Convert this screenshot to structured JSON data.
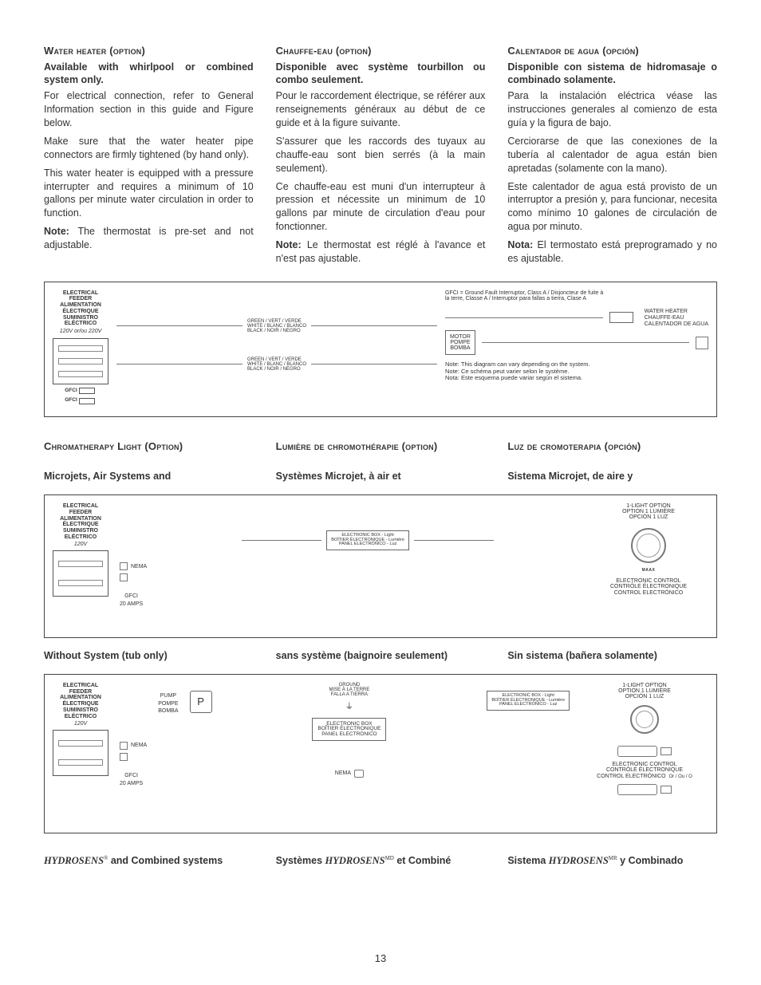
{
  "page_number": "13",
  "sections": {
    "water_heater": {
      "en": {
        "title": "Water heater (option)",
        "subtitle": "Available with whirlpool or combined system only.",
        "p1": "For electrical connection, refer to General Information section in this guide and Figure below.",
        "p2": "Make sure that the water heater pipe connectors are firmly tightened (by hand only).",
        "p3": "This water heater is equipped with a pressure interrupter and requires a minimum of 10 gallons per minute water circulation in order to function.",
        "note_label": "Note:",
        "note": "The thermostat is pre-set and not adjustable."
      },
      "fr": {
        "title": "Chauffe-eau (option)",
        "subtitle": "Disponible avec système tourbillon ou combo seulement.",
        "p1": "Pour le raccordement électrique, se référer aux renseignements généraux au début de ce guide et à la figure suivante.",
        "p2": "S'assurer que les raccords des tuyaux au chauffe-eau sont bien serrés (à la main seulement).",
        "p3": "Ce chauffe-eau est muni d'un interrupteur à pression et nécessite un minimum de 10 gallons par minute de circulation d'eau pour fonctionner.",
        "note_label": "Note:",
        "note": "Le thermostat est réglé à l'avance et n'est pas ajustable."
      },
      "es": {
        "title": "Calentador de agua (opción)",
        "subtitle": "Disponible con sistema de hidromasaje o combinado solamente.",
        "p1": "Para la instalación eléctrica véase las instrucciones generales al comienzo de esta guía y la figura de bajo.",
        "p2": "Cerciorarse de que las conexiones de la tubería al calentador de agua están bien apretadas (solamente con la mano).",
        "p3": "Este calentador de agua está provisto de un interruptor a presión y, para funcionar, necesita como mínimo 10 galones de circulación de agua por minuto.",
        "note_label": "Nota:",
        "note": "El termostato está preprogramado y no es ajustable."
      }
    },
    "chroma": {
      "en": "Chromatherapy Light (Option)",
      "fr": "Lumière de chromothérapie (option)",
      "es": "Luz de cromoterapia (opción)"
    },
    "subA": {
      "en": "Microjets, Air Systems and",
      "fr": "Systèmes Microjet, à air et",
      "es": "Sistema Microjet, de aire y"
    },
    "subB": {
      "en": "Without System (tub only)",
      "fr": "sans système (baignoire seulement)",
      "es": "Sin sistema (bañera solamente)"
    },
    "hydro": {
      "name": "HYDROSENS",
      "en_suffix": " and Combined systems",
      "fr_prefix": "Systèmes ",
      "fr_suffix": " et Combiné",
      "es_prefix": "Sistema ",
      "es_suffix": " y Combinado",
      "sup_en": "®",
      "sup_fr": "MD",
      "sup_es": "MR"
    }
  },
  "diagram1": {
    "feeder": {
      "l1": "ELECTRICAL",
      "l2": "FEEDER",
      "l3": "ALIMENTATION",
      "l4": "ÉLECTRIQUE",
      "l5": "SUMINISTRO",
      "l6": "ELÉCTRICO",
      "volt": "120V or/ou 220V"
    },
    "gfci": "GFCI",
    "wires": {
      "g": "GREEN / VERT / VERDE",
      "w": "WHITE / BLANC / BLANCO",
      "b": "BLACK / NOIR / NEGRO"
    },
    "gfci_legend": "GFCI = Ground Fault Interruptor, Class A / Disjoncteur de fuite à la terre, Classe A / Interruptor para fallas a tierra, Clase A",
    "motor": {
      "l1": "MOTOR",
      "l2": "POMPE",
      "l3": "BOMBA"
    },
    "heater": {
      "l1": "WATER HEATER",
      "l2": "CHAUFFE-EAU",
      "l3": "CALENTADOR DE AGUA"
    },
    "notes": {
      "n1": "Note: This diagram can vary depending on the system.",
      "n2": "Note: Ce schéma peut varier selon le système.",
      "n3": "Nota: Este esquema puede variar según el sistema."
    }
  },
  "diagram2": {
    "feeder_volt": "120V",
    "nema": "NEMA",
    "gfci_amp": {
      "l1": "GFCI",
      "l2": "20 AMPS"
    },
    "ebox": {
      "l1": "ELECTRONIC BOX - Light",
      "l2": "BOÎTIER ÉLECTRONIQUE - Lumière",
      "l3": "PANEL ELECTRÓNICO - Luz"
    },
    "light_opt": {
      "l1": "1-LIGHT OPTION",
      "l2": "OPTION 1 LUMIÈRE",
      "l3": "OPCIÓN 1 LUZ"
    },
    "maax": "MAAX",
    "ctrl": {
      "l1": "ELECTRONIC CONTROL",
      "l2": "CONTRÔLE ÉLECTRONIQUE",
      "l3": "CONTROL ELECTRÓNICO"
    }
  },
  "diagram3": {
    "pump": {
      "l1": "PUMP",
      "l2": "POMPE",
      "l3": "BOMBA",
      "letter": "P"
    },
    "ground": {
      "l1": "GROUND",
      "l2": "MISE À LA TERRE",
      "l3": "FALLA A TIERRA"
    },
    "ebox": {
      "l1": "ELECTRONIC BOX",
      "l2": "BOÎTIER ÉLECTRONIQUE",
      "l3": "PANEL ELECTRÓNICO"
    },
    "nema": "NEMA",
    "or": "Or / Ou / O"
  }
}
